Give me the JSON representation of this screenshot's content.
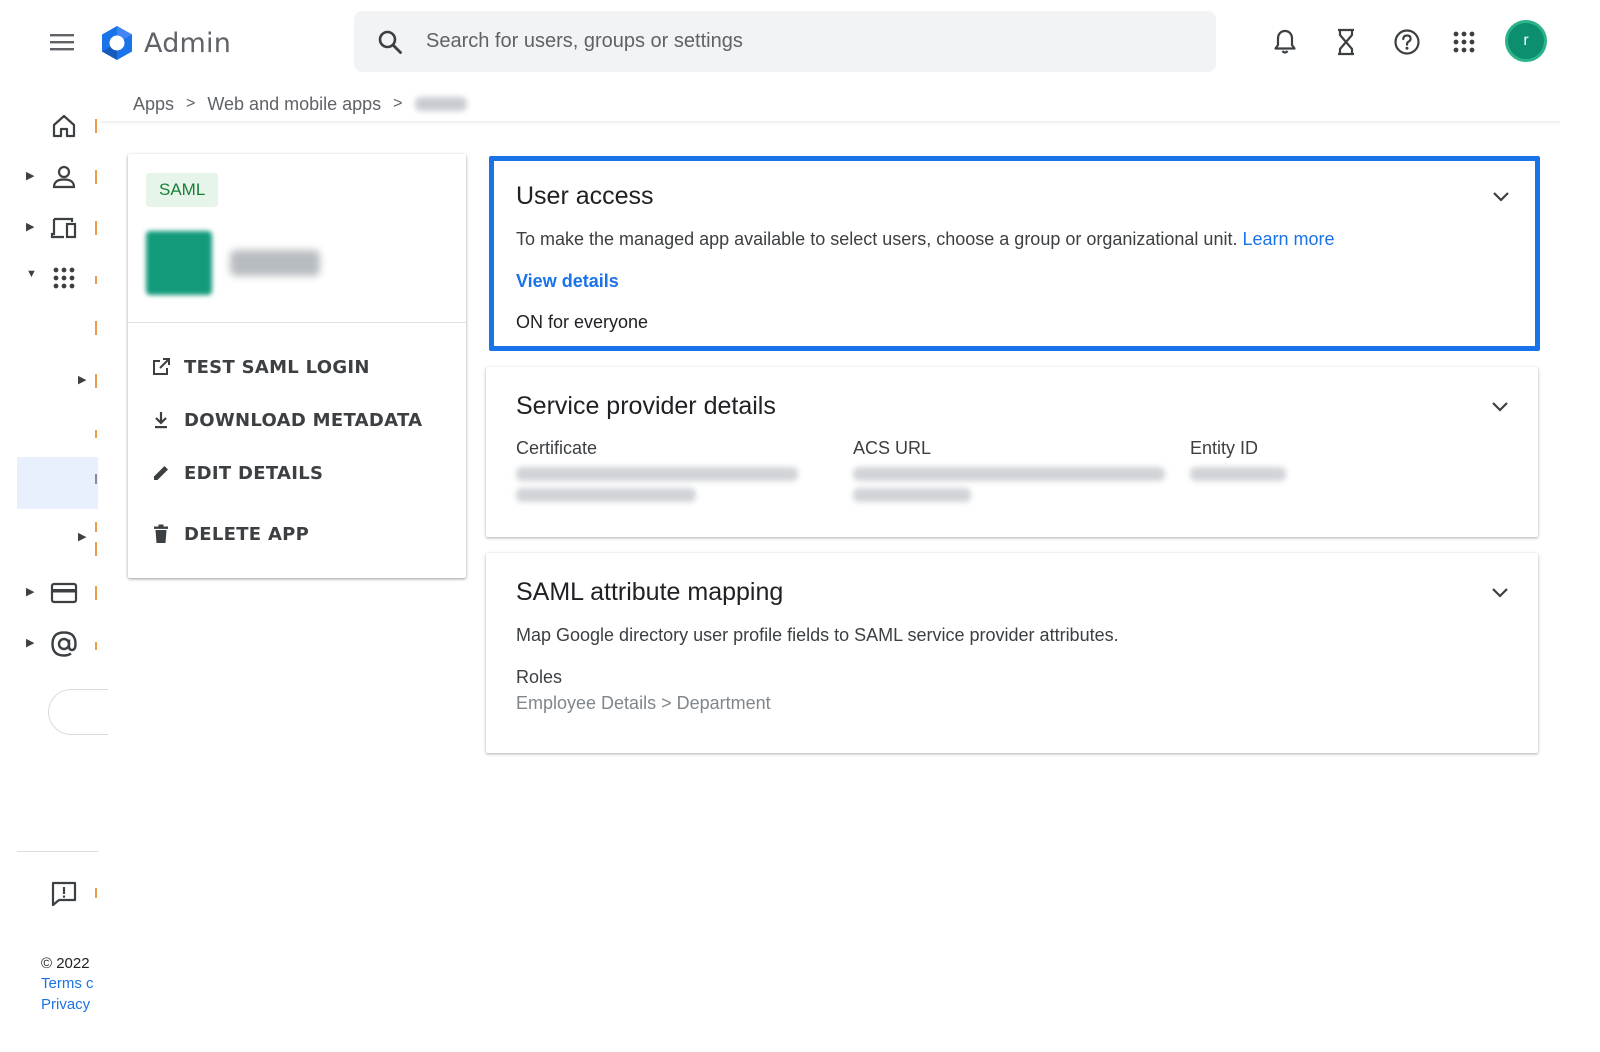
{
  "header": {
    "app_name": "Admin",
    "search_placeholder": "Search for users, groups or settings",
    "avatar_initial": "r"
  },
  "breadcrumb": {
    "items": [
      "Apps",
      "Web and mobile apps"
    ],
    "separator": ">"
  },
  "app_card": {
    "chip": "SAML",
    "actions": [
      {
        "label": "TEST SAML LOGIN",
        "icon": "open-in-new-icon"
      },
      {
        "label": "DOWNLOAD METADATA",
        "icon": "download-icon"
      },
      {
        "label": "EDIT DETAILS",
        "icon": "pencil-icon"
      },
      {
        "label": "DELETE APP",
        "icon": "trash-icon"
      }
    ]
  },
  "user_access": {
    "title": "User access",
    "description": "To make the managed app available to select users, choose a group or organizational unit.",
    "learn_more": "Learn more",
    "view_details": "View details",
    "status": "ON for everyone"
  },
  "service_provider": {
    "title": "Service provider details",
    "columns": [
      "Certificate",
      "ACS URL",
      "Entity ID"
    ]
  },
  "saml_mapping": {
    "title": "SAML attribute mapping",
    "description": "Map Google directory user profile fields to SAML service provider attributes.",
    "roles_label": "Roles",
    "roles_value": "Employee Details > Department"
  },
  "footer": {
    "copyright": "© 2022",
    "terms": "Terms c",
    "privacy": "Privacy"
  },
  "colors": {
    "accent": "#1a73e8",
    "chip_bg": "#e6f4ea",
    "chip_text": "#188038",
    "avatar": "#0b8f6f"
  }
}
